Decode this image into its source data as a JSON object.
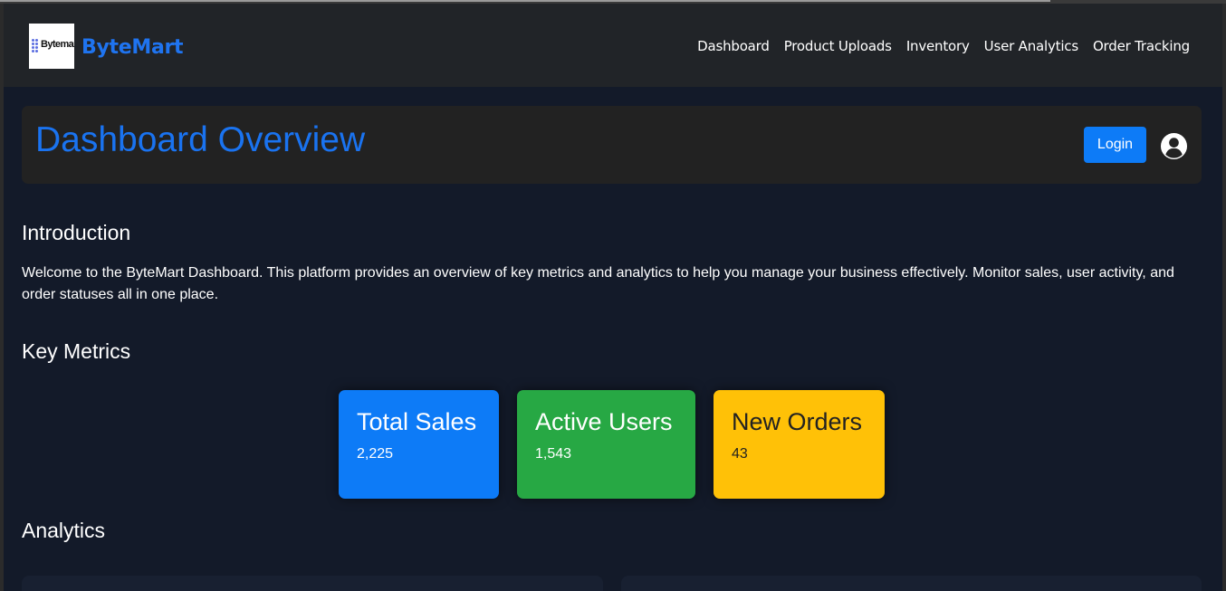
{
  "brand": {
    "logo_text": "Bytemart",
    "name": "ByteMart"
  },
  "nav": {
    "links": [
      "Dashboard",
      "Product Uploads",
      "Inventory",
      "User Analytics",
      "Order Tracking"
    ]
  },
  "header": {
    "title": "Dashboard Overview",
    "login_label": "Login",
    "user_icon": "user-circle-icon"
  },
  "intro": {
    "heading": "Introduction",
    "text": "Welcome to the ByteMart Dashboard. This platform provides an overview of key metrics and analytics to help you manage your business effectively. Monitor sales, user activity, and order statuses all in one place."
  },
  "metrics": {
    "heading": "Key Metrics",
    "cards": [
      {
        "title": "Total Sales",
        "value": "2,225",
        "color": "#0d7bf7",
        "text_color": "#ffffff"
      },
      {
        "title": "Active Users",
        "value": "1,543",
        "color": "#27a844",
        "text_color": "#ffffff"
      },
      {
        "title": "New Orders",
        "value": "43",
        "color": "#ffc107",
        "text_color": "#222222"
      }
    ]
  },
  "analytics": {
    "heading": "Analytics"
  },
  "colors": {
    "accent": "#1a73f0",
    "background": "#131a29",
    "navbar": "#212428"
  }
}
